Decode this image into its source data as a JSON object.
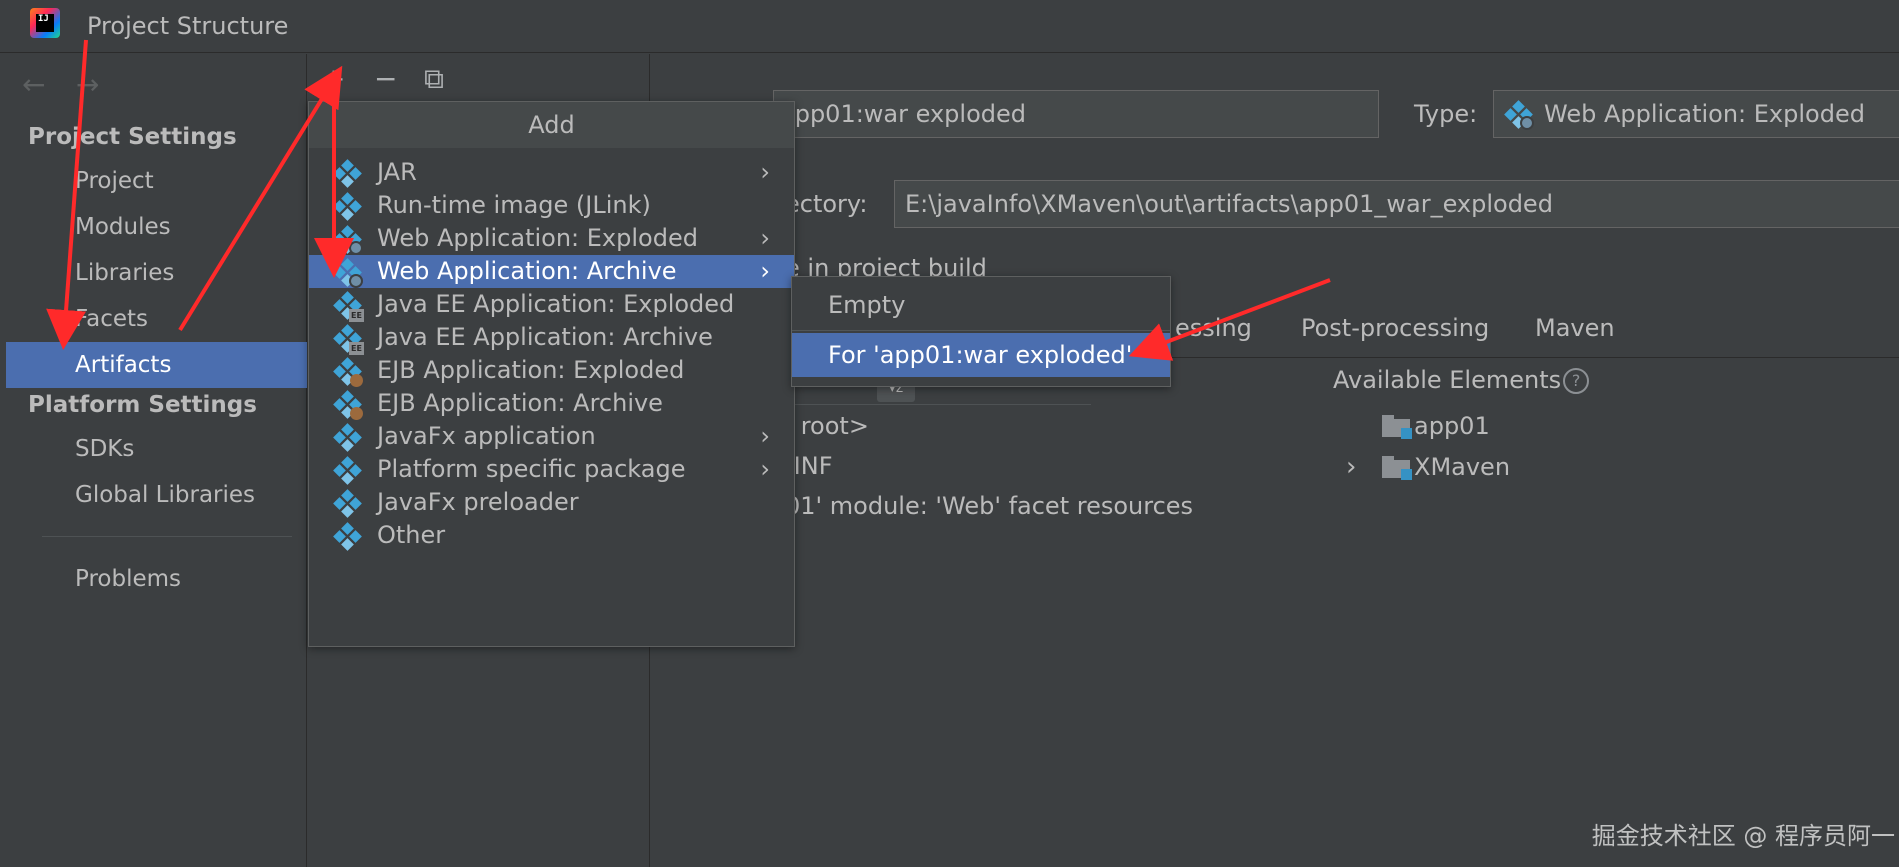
{
  "window": {
    "title": "Project Structure",
    "logo_text": "IJ"
  },
  "nav": {
    "back_glyph": "←",
    "forward_glyph": "→"
  },
  "sidebar": {
    "project_settings_title": "Project Settings",
    "project_items": [
      {
        "label": "Project"
      },
      {
        "label": "Modules"
      },
      {
        "label": "Libraries"
      },
      {
        "label": "Facets"
      },
      {
        "label": "Artifacts",
        "selected": true
      }
    ],
    "platform_settings_title": "Platform Settings",
    "platform_items": [
      {
        "label": "SDKs"
      },
      {
        "label": "Global Libraries"
      }
    ],
    "problems_label": "Problems"
  },
  "toolbar": {
    "add_glyph": "+",
    "remove_glyph": "−",
    "copy_glyph": "⧉"
  },
  "artifact": {
    "name_value": "app01:war exploded",
    "type_label": "Type:",
    "type_value": "Web Application: Exploded",
    "directory_label": "ectory:",
    "directory_value": "E:\\javaInfo\\XMaven\\out\\artifacts\\app01_war_exploded",
    "include_label": "e in project build"
  },
  "tabs": [
    "essing",
    "Post-processing",
    "Maven"
  ],
  "output_tree": [
    {
      "label": ": root>"
    },
    {
      "label": "-INF"
    },
    {
      "label": "01' module: 'Web' facet resources"
    }
  ],
  "available": {
    "title": "Available Elements",
    "help_glyph": "?",
    "items": [
      {
        "label": "app01",
        "expandable": false
      },
      {
        "label": "XMaven",
        "expandable": true,
        "chevron": "›"
      }
    ]
  },
  "add_menu": {
    "header": "Add",
    "items": [
      {
        "label": "JAR",
        "badge": "",
        "submenu": true
      },
      {
        "label": "Run-time image (JLink)",
        "badge": "",
        "submenu": false
      },
      {
        "label": "Web Application: Exploded",
        "badge": "globe",
        "submenu": true
      },
      {
        "label": "Web Application: Archive",
        "badge": "globe",
        "submenu": true,
        "active": true
      },
      {
        "label": "Java EE Application: Exploded",
        "badge": "ee",
        "submenu": false
      },
      {
        "label": "Java EE Application: Archive",
        "badge": "ee",
        "submenu": false
      },
      {
        "label": "EJB Application: Exploded",
        "badge": "bean",
        "submenu": false
      },
      {
        "label": "EJB Application: Archive",
        "badge": "bean",
        "submenu": false
      },
      {
        "label": "JavaFx application",
        "badge": "",
        "submenu": true
      },
      {
        "label": "Platform specific package",
        "badge": "",
        "submenu": true
      },
      {
        "label": "JavaFx preloader",
        "badge": "",
        "submenu": false
      },
      {
        "label": "Other",
        "badge": "",
        "submenu": false
      }
    ],
    "chevron": "›"
  },
  "sub_menu": {
    "items": [
      {
        "label": "Empty"
      },
      {
        "label": "For 'app01:war exploded'",
        "active": true
      }
    ]
  },
  "watermark": "掘金技术社区 @ 程序员阿一",
  "colors": {
    "selection": "#4b6eaf",
    "annotation_arrow": "#ff2a2a",
    "background": "#3c3f41"
  }
}
